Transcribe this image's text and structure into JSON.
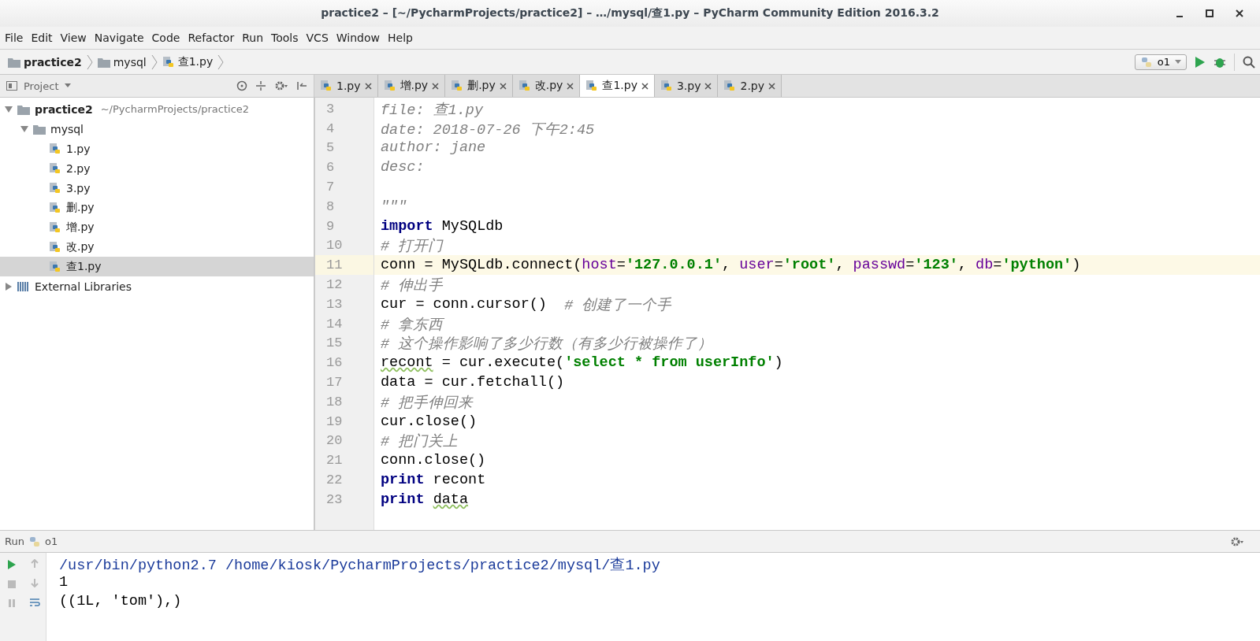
{
  "window": {
    "title": "practice2 – [~/PycharmProjects/practice2] – …/mysql/查1.py – PyCharm Community Edition 2016.3.2"
  },
  "menu": [
    "File",
    "Edit",
    "View",
    "Navigate",
    "Code",
    "Refactor",
    "Run",
    "Tools",
    "VCS",
    "Window",
    "Help"
  ],
  "breadcrumb": [
    {
      "label": "practice2",
      "kind": "project"
    },
    {
      "label": "mysql",
      "kind": "folder"
    },
    {
      "label": "查1.py",
      "kind": "file"
    }
  ],
  "run_config": {
    "label": "o1"
  },
  "project_panel": {
    "title": "Project",
    "tree": [
      {
        "label": "practice2",
        "path": "~/PycharmProjects/practice2",
        "kind": "folder",
        "expanded": true,
        "selected": false,
        "children": [
          {
            "label": "mysql",
            "kind": "folder",
            "expanded": true,
            "selected": false,
            "children": [
              {
                "label": "1.py",
                "kind": "file",
                "selected": false
              },
              {
                "label": "2.py",
                "kind": "file",
                "selected": false
              },
              {
                "label": "3.py",
                "kind": "file",
                "selected": false
              },
              {
                "label": "删.py",
                "kind": "file",
                "selected": false
              },
              {
                "label": "增.py",
                "kind": "file",
                "selected": false
              },
              {
                "label": "改.py",
                "kind": "file",
                "selected": false
              },
              {
                "label": "查1.py",
                "kind": "file",
                "selected": true
              }
            ]
          }
        ]
      },
      {
        "label": "External Libraries",
        "kind": "library",
        "expanded": false,
        "selected": false
      }
    ]
  },
  "tabs": [
    {
      "label": "1.py",
      "selected": false
    },
    {
      "label": "增.py",
      "selected": false
    },
    {
      "label": "删.py",
      "selected": false
    },
    {
      "label": "改.py",
      "selected": false
    },
    {
      "label": "查1.py",
      "selected": true
    },
    {
      "label": "3.py",
      "selected": false
    },
    {
      "label": "2.py",
      "selected": false
    }
  ],
  "editor": {
    "lines": [
      {
        "number": "3",
        "current": false,
        "tokens": [
          {
            "kind": "doc",
            "text": "file: 查1.py"
          }
        ]
      },
      {
        "number": "4",
        "current": false,
        "tokens": [
          {
            "kind": "doc",
            "text": "date: 2018-07-26 下午2:45"
          }
        ]
      },
      {
        "number": "5",
        "current": false,
        "tokens": [
          {
            "kind": "doc",
            "text": "author: jane"
          }
        ]
      },
      {
        "number": "6",
        "current": false,
        "tokens": [
          {
            "kind": "doc",
            "text": "desc:"
          }
        ]
      },
      {
        "number": "7",
        "current": false
      },
      {
        "number": "8",
        "current": false,
        "tokens": [
          {
            "kind": "doc",
            "text": "\"\"\""
          }
        ]
      },
      {
        "number": "9",
        "current": false,
        "tokens": [
          {
            "kind": "kw",
            "text": "import"
          },
          {
            "kind": "plain",
            "text": " MySQLdb"
          }
        ]
      },
      {
        "number": "10",
        "current": false,
        "tokens": [
          {
            "kind": "comment",
            "text": "# 打开门"
          }
        ]
      },
      {
        "number": "11",
        "current": true,
        "tokens": [
          {
            "kind": "plain",
            "text": "conn = MySQLdb.connect("
          },
          {
            "kind": "param",
            "text": "host"
          },
          {
            "kind": "plain",
            "text": "="
          },
          {
            "kind": "str",
            "text": "'127.0.0.1'"
          },
          {
            "kind": "plain",
            "text": ", "
          },
          {
            "kind": "param",
            "text": "user"
          },
          {
            "kind": "plain",
            "text": "="
          },
          {
            "kind": "str",
            "text": "'root'"
          },
          {
            "kind": "plain",
            "text": ", "
          },
          {
            "kind": "param",
            "text": "passwd"
          },
          {
            "kind": "plain",
            "text": "="
          },
          {
            "kind": "str",
            "text": "'123'"
          },
          {
            "kind": "plain",
            "text": ", "
          },
          {
            "kind": "param",
            "text": "db"
          },
          {
            "kind": "plain",
            "text": "="
          },
          {
            "kind": "str",
            "text": "'python'"
          },
          {
            "kind": "plain",
            "text": ")"
          }
        ]
      },
      {
        "number": "12",
        "current": false,
        "tokens": [
          {
            "kind": "comment",
            "text": "# 伸出手"
          }
        ]
      },
      {
        "number": "13",
        "current": false,
        "tokens": [
          {
            "kind": "plain",
            "text": "cur = conn.cursor()  "
          },
          {
            "kind": "comment",
            "text": "# 创建了一个手"
          }
        ]
      },
      {
        "number": "14",
        "current": false,
        "tokens": [
          {
            "kind": "comment",
            "text": "# 拿东西"
          }
        ]
      },
      {
        "number": "15",
        "current": false,
        "tokens": [
          {
            "kind": "comment",
            "text": "# 这个操作影响了多少行数（有多少行被操作了）"
          }
        ]
      },
      {
        "number": "16",
        "current": false,
        "tokens": [
          {
            "kind": "warn",
            "text": "recont"
          },
          {
            "kind": "plain",
            "text": " = cur.execute("
          },
          {
            "kind": "str",
            "text": "'select * from userInfo'"
          },
          {
            "kind": "plain",
            "text": ")"
          }
        ]
      },
      {
        "number": "17",
        "current": false,
        "tokens": [
          {
            "kind": "plain",
            "text": "data = cur.fetchall()"
          }
        ]
      },
      {
        "number": "18",
        "current": false,
        "tokens": [
          {
            "kind": "comment",
            "text": "# 把手伸回来"
          }
        ]
      },
      {
        "number": "19",
        "current": false,
        "tokens": [
          {
            "kind": "plain",
            "text": "cur.close()"
          }
        ]
      },
      {
        "number": "20",
        "current": false,
        "tokens": [
          {
            "kind": "comment",
            "text": "# 把门关上"
          }
        ]
      },
      {
        "number": "21",
        "current": false,
        "tokens": [
          {
            "kind": "plain",
            "text": "conn.close()"
          }
        ]
      },
      {
        "number": "22",
        "current": false,
        "tokens": [
          {
            "kind": "kw",
            "text": "print"
          },
          {
            "kind": "plain",
            "text": " recont"
          }
        ]
      },
      {
        "number": "23",
        "current": false,
        "tokens": [
          {
            "kind": "kw",
            "text": "print "
          },
          {
            "kind": "warn",
            "text": "data"
          }
        ]
      }
    ]
  },
  "run_panel": {
    "title": "Run",
    "config": "o1",
    "output": [
      {
        "kind": "command",
        "text": "/usr/bin/python2.7 /home/kiosk/PycharmProjects/practice2/mysql/查1.py"
      },
      {
        "kind": "stdout",
        "text": "1"
      },
      {
        "kind": "stdout",
        "text": "((1L, 'tom'),)"
      }
    ]
  }
}
